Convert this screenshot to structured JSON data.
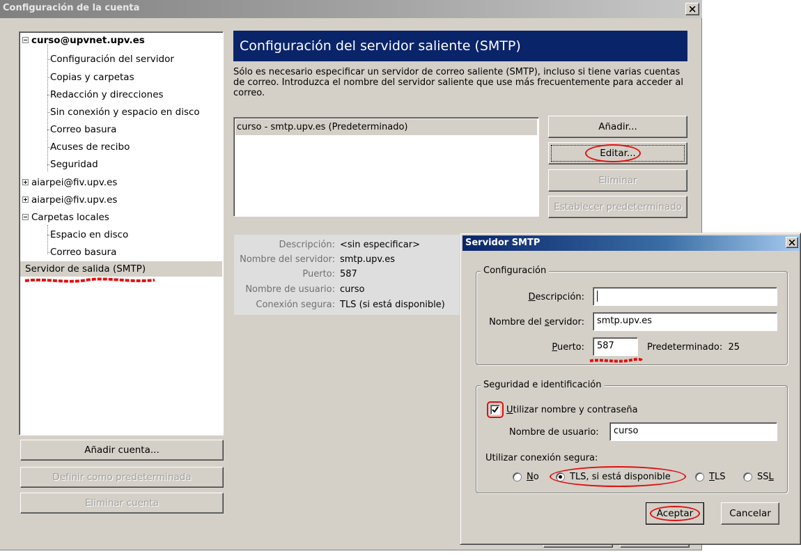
{
  "main_window": {
    "title": "Configuración de la cuenta",
    "close_label": "X"
  },
  "tree": {
    "account1": "curso@upvnet.upv.es",
    "account1_children": [
      "Configuración del servidor",
      "Copias y carpetas",
      "Redacción y direcciones",
      "Sin conexión y espacio en disco",
      "Correo basura",
      "Acuses de recibo",
      "Seguridad"
    ],
    "account2": "aiarpei@fiv.upv.es",
    "account3": "aiarpei@fiv.upv.es",
    "local_folders": "Carpetas locales",
    "local_children": [
      "Espacio en disco",
      "Correo basura"
    ],
    "smtp_item": "Servidor de salida (SMTP)"
  },
  "account_buttons": {
    "add": "Añadir cuenta...",
    "set_default": "Definir como predeterminada",
    "remove": "Eliminar cuenta"
  },
  "smtp_page": {
    "header": "Configuración del servidor saliente (SMTP)",
    "description": "Sólo es necesario especificar un servidor de correo saliente (SMTP), incluso si tiene varias cuentas de correo. Introduzca el nombre del servidor saliente que use más frecuentemente para acceder al correo.",
    "servers": [
      "curso - smtp.upv.es (Predeterminado)"
    ],
    "buttons": {
      "add": "Añadir...",
      "edit": "Editar...",
      "delete": "Eliminar",
      "set_default": "Establecer predeterminado"
    },
    "details": [
      {
        "label": "Descripción:",
        "value": "<sin especificar>"
      },
      {
        "label": "Nombre del servidor:",
        "value": "smtp.upv.es"
      },
      {
        "label": "Puerto:",
        "value": "587"
      },
      {
        "label": "Nombre de usuario:",
        "value": "curso"
      },
      {
        "label": "Conexión segura:",
        "value": "TLS (si está disponible)"
      }
    ]
  },
  "dialog": {
    "title": "Servidor SMTP",
    "close_label": "X",
    "config_group": "Configuración",
    "description_label": "Descripción:",
    "description_value": "",
    "server_label": "Nombre del servidor:",
    "server_value": "smtp.upv.es",
    "port_label": "Puerto:",
    "port_value": "587",
    "default_port_label": "Predeterminado:",
    "default_port_value": "25",
    "security_group": "Seguridad e identificación",
    "use_auth_label": "Utilizar nombre y contraseña",
    "use_auth_checked": true,
    "username_label": "Nombre de usuario:",
    "username_value": "curso",
    "secure_label": "Utilizar conexión segura:",
    "secure_options": [
      "No",
      "TLS, si está disponible",
      "TLS",
      "SSL"
    ],
    "secure_selected": "TLS, si está disponible",
    "ok": "Aceptar",
    "cancel": "Cancelar"
  },
  "colors": {
    "header_blue": "#0a246a",
    "highlight_red": "#e01010",
    "window_gray": "#d4d0c8"
  }
}
